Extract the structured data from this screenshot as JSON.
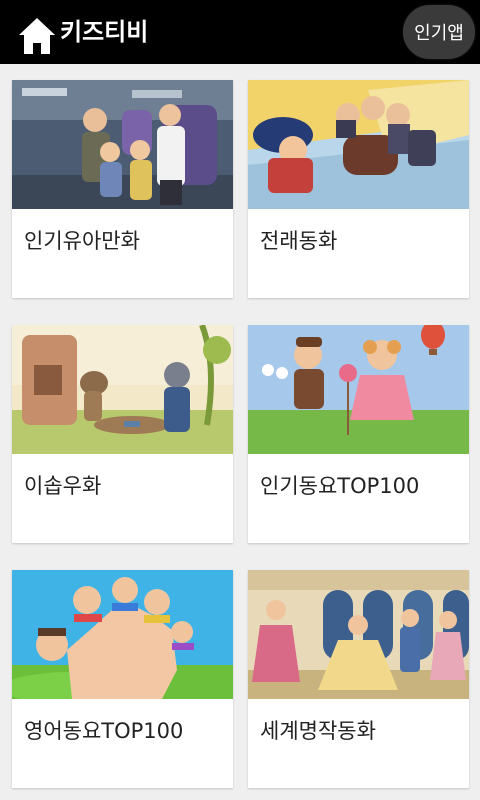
{
  "header": {
    "title": "키즈티비",
    "popular_button": "인기앱"
  },
  "cards": [
    {
      "label": "인기유아만화"
    },
    {
      "label": "전래동화"
    },
    {
      "label": "이솝우화"
    },
    {
      "label": "인기동요TOP100"
    },
    {
      "label": "영어동요TOP100"
    },
    {
      "label": "세계명작동화"
    }
  ]
}
